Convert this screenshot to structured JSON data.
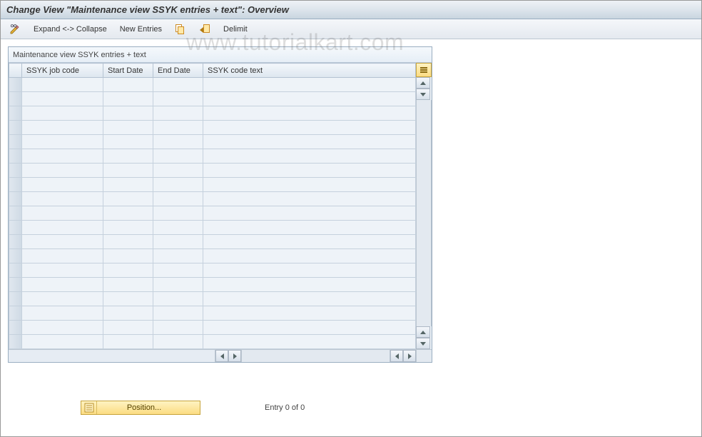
{
  "title": "Change View \"Maintenance view SSYK entries + text\": Overview",
  "toolbar": {
    "expand_collapse": "Expand <-> Collapse",
    "new_entries": "New Entries",
    "delimit": "Delimit"
  },
  "table": {
    "caption": "Maintenance view SSYK entries + text",
    "columns": {
      "ssyk_job_code": "SSYK job code",
      "start_date": "Start Date",
      "end_date": "End Date",
      "ssyk_code_text": "SSYK code text"
    },
    "row_count": 19
  },
  "footer": {
    "position_label": "Position...",
    "entry_text": "Entry 0 of 0"
  },
  "watermark": "www.tutorialkart.com"
}
